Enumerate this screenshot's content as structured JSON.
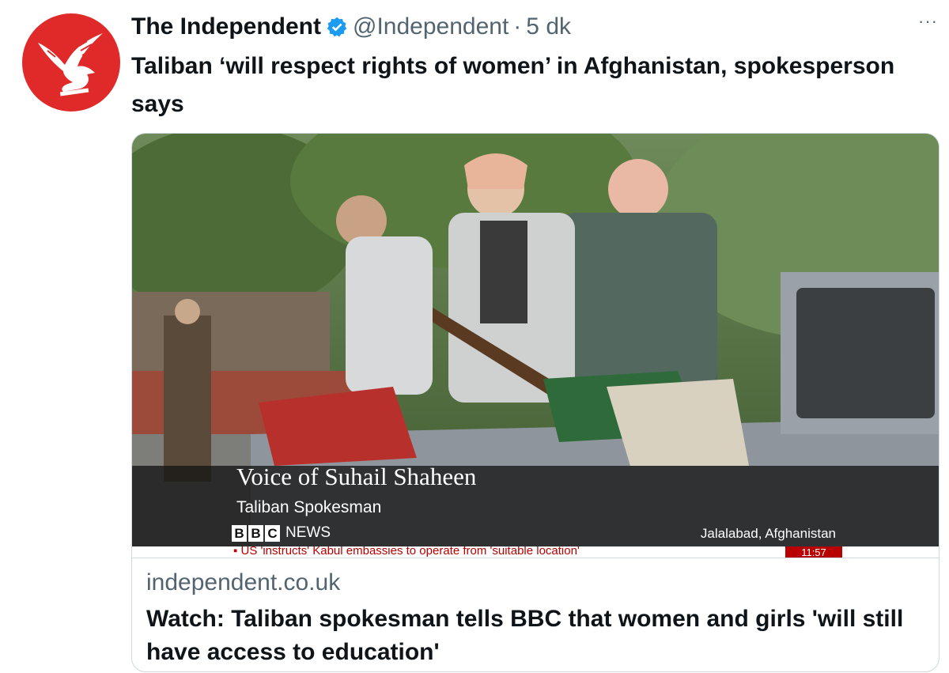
{
  "tweet": {
    "author_name": "The Independent",
    "handle": "@Independent",
    "separator": "·",
    "time": "5 dk",
    "more": "···",
    "text": "Taliban ‘will respect rights of women’ in Afghanistan, spokesperson says"
  },
  "card": {
    "domain": "independent.co.uk",
    "title": "Watch: Taliban spokesman tells BBC that women and girls 'will still have access to education'"
  },
  "video_frame": {
    "lower_third_name": "Voice of Suhail Shaheen",
    "lower_third_role": "Taliban Spokesman",
    "bbc_letters": [
      "B",
      "B",
      "C"
    ],
    "bbc_news": "NEWS",
    "location": "Jalalabad, Afghanistan",
    "ticker": "▪ US 'instructs' Kabul embassies to operate from 'suitable location'",
    "ticker_time": "11:57"
  },
  "colors": {
    "avatar_bg": "#e02a2a",
    "verified": "#1d9bf0",
    "secondary_text": "#536471",
    "primary_text": "#0f1419",
    "border": "#cfd9de",
    "bbc_red": "#b80000"
  },
  "icons": {
    "avatar": "eagle-logo",
    "verified": "verified-badge-icon",
    "more": "more-options-icon"
  }
}
